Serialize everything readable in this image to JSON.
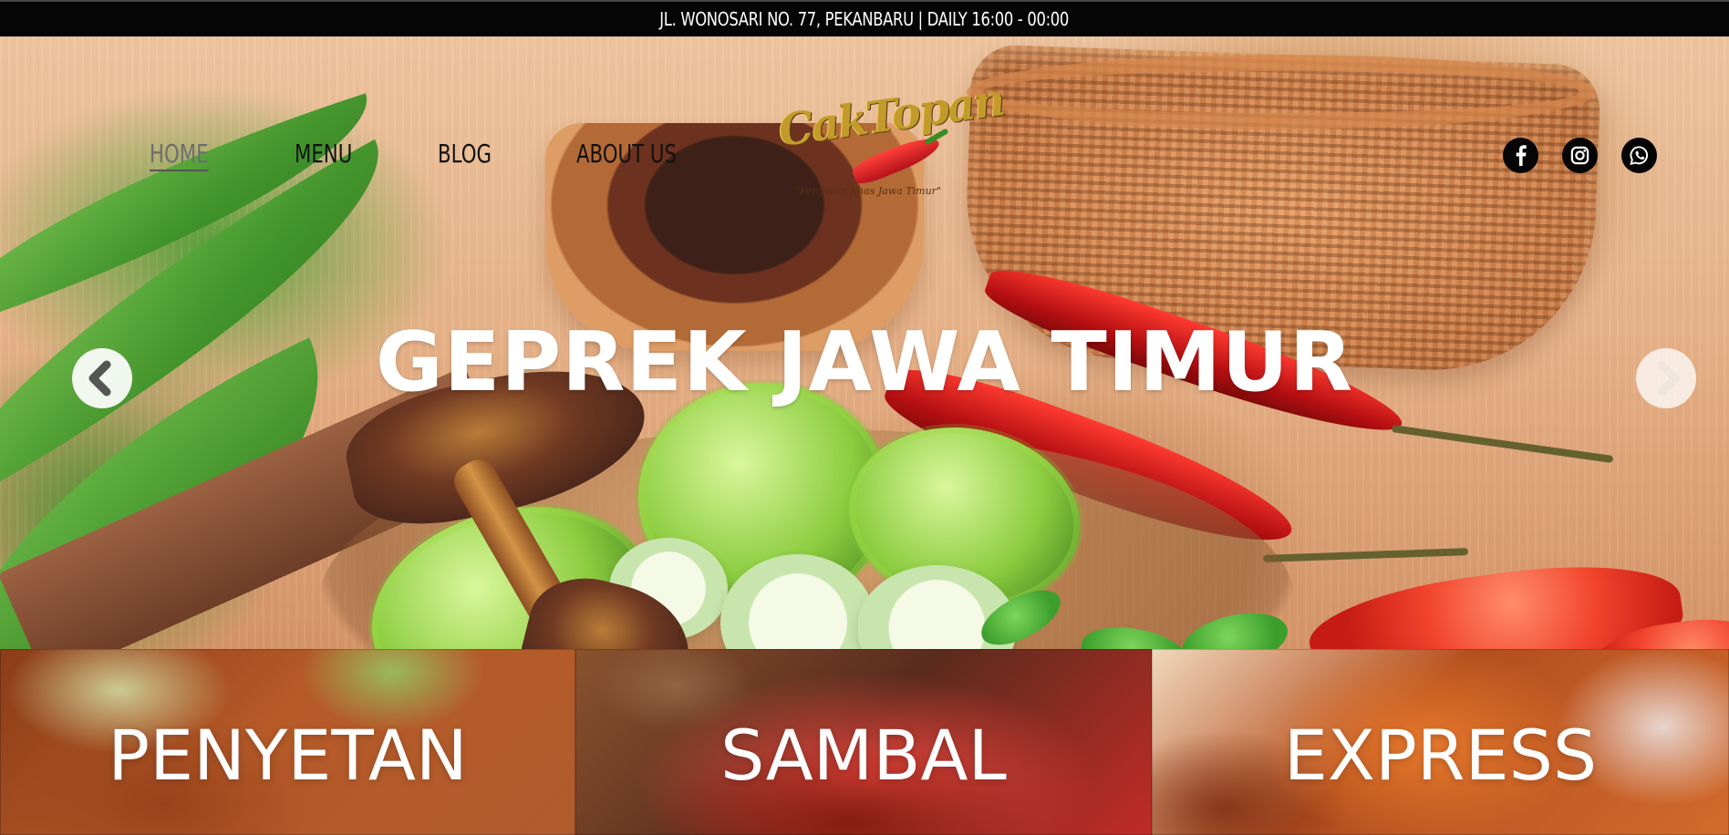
{
  "top_bar": {
    "text": "JL. WONOSARI NO. 77, PEKANBARU | DAILY 16:00 - 00:00"
  },
  "nav": {
    "items": [
      {
        "label": "HOME",
        "active": true
      },
      {
        "label": "MENU",
        "active": false
      },
      {
        "label": "BLOG",
        "active": false
      },
      {
        "label": "ABOUT US",
        "active": false
      }
    ]
  },
  "logo": {
    "text": "CakTopan",
    "tagline": "\"Penyetan Khas Jawa Timur\""
  },
  "socials": [
    {
      "name": "facebook-icon"
    },
    {
      "name": "instagram-icon"
    },
    {
      "name": "whatsapp-icon"
    }
  ],
  "hero": {
    "title": "GEPREK JAWA TIMUR",
    "arrows": {
      "left": "chevron-left-icon",
      "right": "chevron-right-icon"
    }
  },
  "categories": [
    {
      "label": "PENYETAN"
    },
    {
      "label": "SAMBAL"
    },
    {
      "label": "EXPRESS"
    }
  ],
  "colors": {
    "top_bar": "#050505",
    "nav_text": "#111111",
    "active_nav": "#6d6d6d",
    "logo_gold": "#c39b2a",
    "white": "#ffffff"
  }
}
